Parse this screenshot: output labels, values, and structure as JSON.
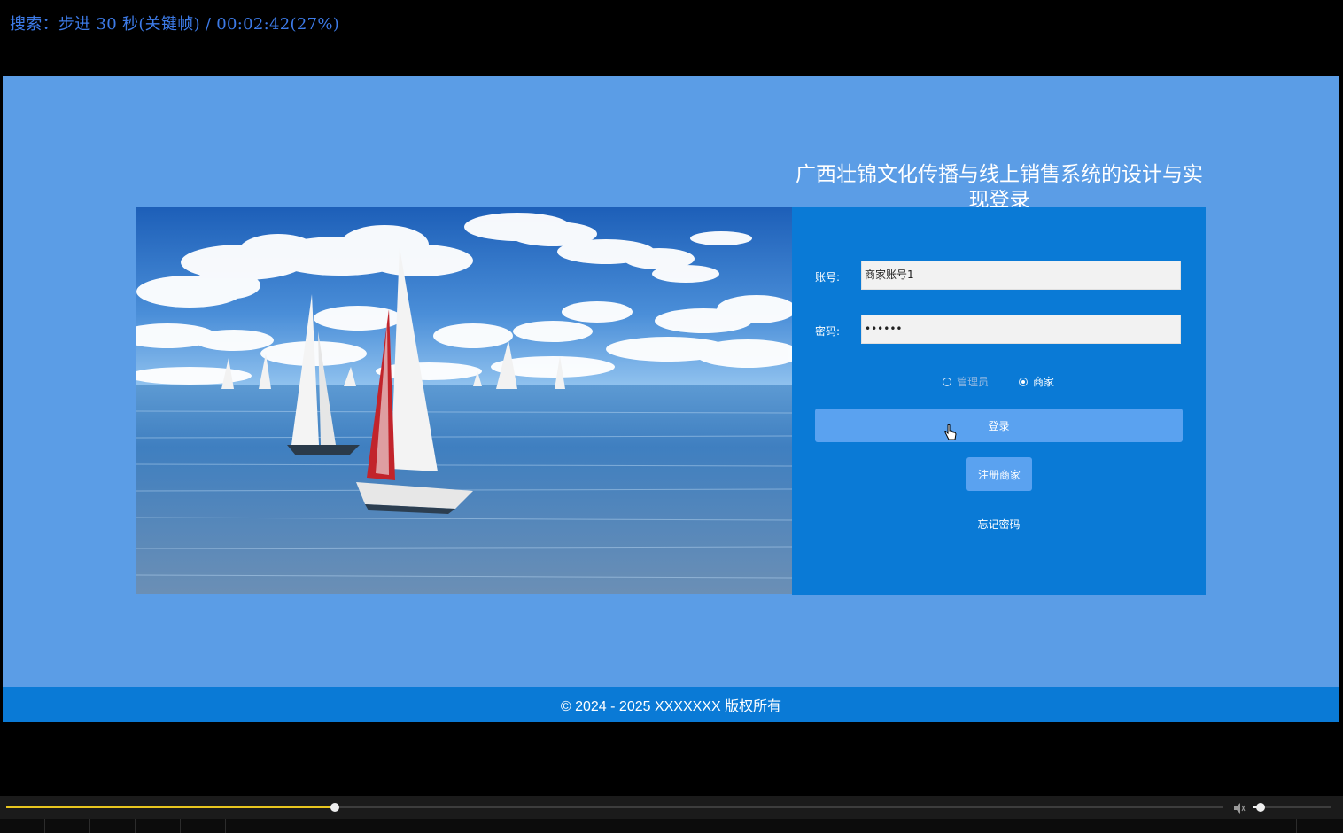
{
  "osd": {
    "text": "搜索：步进 30 秒(关键帧) / 00:02:42(27%)"
  },
  "page": {
    "title": "广西壮锦文化传播与线上销售系统的设计与实现登录",
    "footer": "© 2024 - 2025 XXXXXXX 版权所有",
    "background_color": "#5b9de6",
    "panel_color": "#0a7ad6",
    "button_color": "#5aa2f0"
  },
  "login": {
    "account_label": "账号:",
    "account_value": "商家账号1",
    "password_label": "密码:",
    "password_value": "••••••",
    "roles": [
      {
        "label": "管理员",
        "selected": false
      },
      {
        "label": "商家",
        "selected": true
      }
    ],
    "login_button": "登录",
    "register_button": "注册商家",
    "forgot_link": "忘记密码"
  },
  "hero_image": {
    "icon": "sailboats-on-sea-photo"
  },
  "player": {
    "seek_progress": 0.27,
    "volume_level": 0.1,
    "seek_color": "#e8c51f"
  }
}
